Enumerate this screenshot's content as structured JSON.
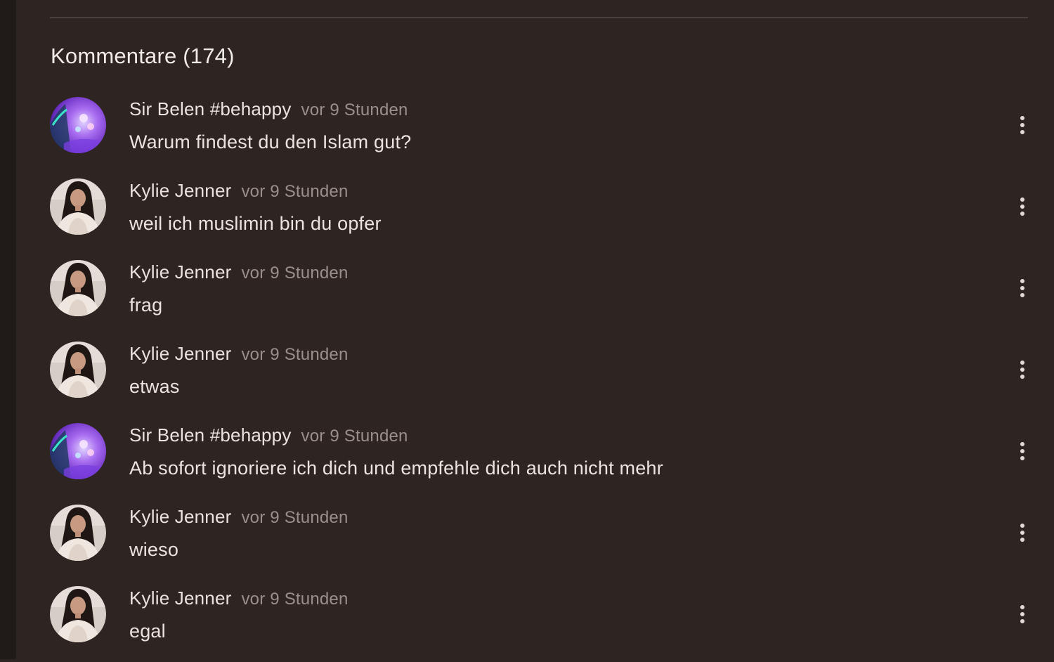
{
  "comments_section": {
    "heading": "Kommentare (174)"
  },
  "comments": [
    {
      "author": "Sir Belen #behappy",
      "time": "vor 9 Stunden",
      "text": "Warum findest du den Islam gut?",
      "avatar": "sir-belen-avatar"
    },
    {
      "author": "Kylie Jenner",
      "time": "vor 9 Stunden",
      "text": "weil ich muslimin bin du opfer",
      "avatar": "kylie-jenner-avatar"
    },
    {
      "author": "Kylie Jenner",
      "time": "vor 9 Stunden",
      "text": "frag",
      "avatar": "kylie-jenner-avatar"
    },
    {
      "author": "Kylie Jenner",
      "time": "vor 9 Stunden",
      "text": "etwas",
      "avatar": "kylie-jenner-avatar"
    },
    {
      "author": "Sir Belen #behappy",
      "time": "vor 9 Stunden",
      "text": "Ab sofort ignoriere ich dich und empfehle dich auch nicht mehr",
      "avatar": "sir-belen-avatar"
    },
    {
      "author": "Kylie Jenner",
      "time": "vor 9 Stunden",
      "text": "wieso",
      "avatar": "kylie-jenner-avatar"
    },
    {
      "author": "Kylie Jenner",
      "time": "vor 9 Stunden",
      "text": "egal",
      "avatar": "kylie-jenner-avatar"
    }
  ],
  "icons": {
    "more_options": "more-vertical-icon"
  },
  "colors": {
    "background": "#2e2522",
    "sidebar_strip": "#201a18",
    "primary_text": "#eae3df",
    "secondary_text": "#9a8f8a",
    "divider": "#4a403c"
  }
}
